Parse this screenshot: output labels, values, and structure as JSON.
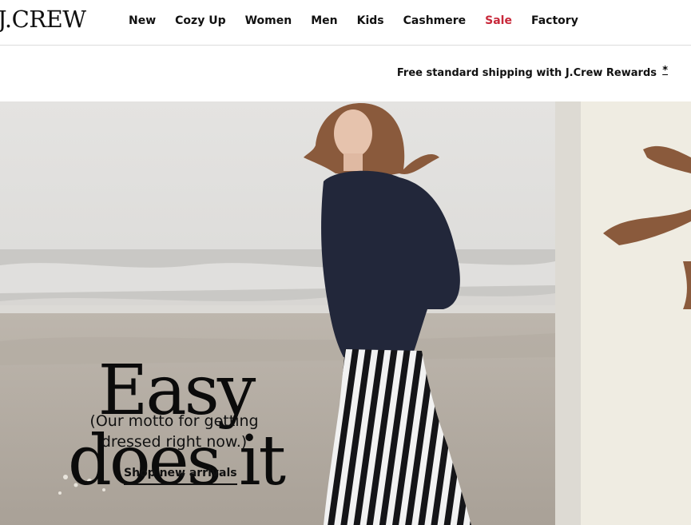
{
  "brand": {
    "logo_text": "J.CREW"
  },
  "nav": {
    "items": [
      {
        "label": "New"
      },
      {
        "label": "Cozy Up"
      },
      {
        "label": "Women"
      },
      {
        "label": "Men"
      },
      {
        "label": "Kids"
      },
      {
        "label": "Cashmere"
      },
      {
        "label": "Sale"
      },
      {
        "label": "Factory"
      }
    ]
  },
  "promo": {
    "text": "Free standard shipping with J.Crew Rewards",
    "asterisk": "*"
  },
  "hero": {
    "headline_line1": "Easy",
    "headline_line2": "does it",
    "subtext": "(Our motto for getting dressed right now.)",
    "cta_label": "Shop new arrivals"
  },
  "colors": {
    "sale": "#c8283a",
    "text": "#111111",
    "divider": "#dcdcdc"
  }
}
